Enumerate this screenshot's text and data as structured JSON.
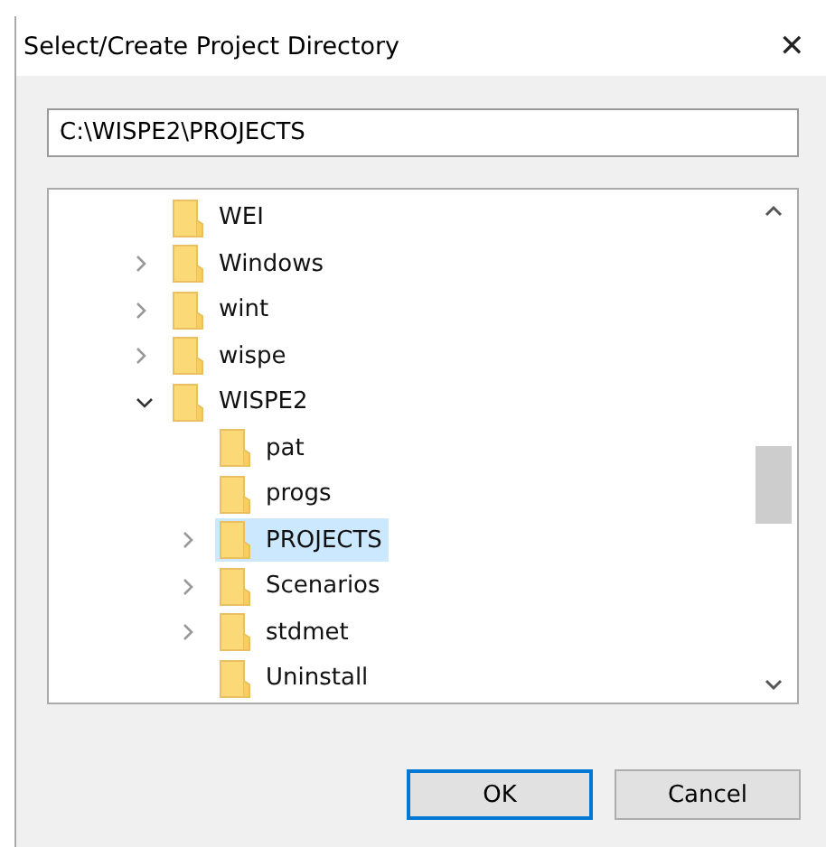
{
  "window": {
    "title": "Select/Create Project Directory",
    "close": "✕"
  },
  "path_field": {
    "value": "C:\\WISPE2\\PROJECTS"
  },
  "tree": [
    {
      "label": "WEI",
      "selected": false
    },
    {
      "label": "Windows",
      "expanded": false,
      "selected": false
    },
    {
      "label": "wint",
      "expanded": false,
      "selected": false
    },
    {
      "label": "wispe",
      "expanded": false,
      "selected": false
    },
    {
      "label": "WISPE2",
      "expanded": true,
      "selected": false,
      "children": [
        {
          "label": "pat",
          "selected": false
        },
        {
          "label": "progs",
          "selected": false
        },
        {
          "label": "PROJECTS",
          "expanded": false,
          "selected": true
        },
        {
          "label": "Scenarios",
          "expanded": false,
          "selected": false
        },
        {
          "label": "stdmet",
          "expanded": false,
          "selected": false
        },
        {
          "label": "Uninstall",
          "selected": false
        }
      ]
    }
  ],
  "buttons": [
    {
      "label": "OK",
      "default": true
    },
    {
      "label": "Cancel",
      "default": false
    }
  ]
}
